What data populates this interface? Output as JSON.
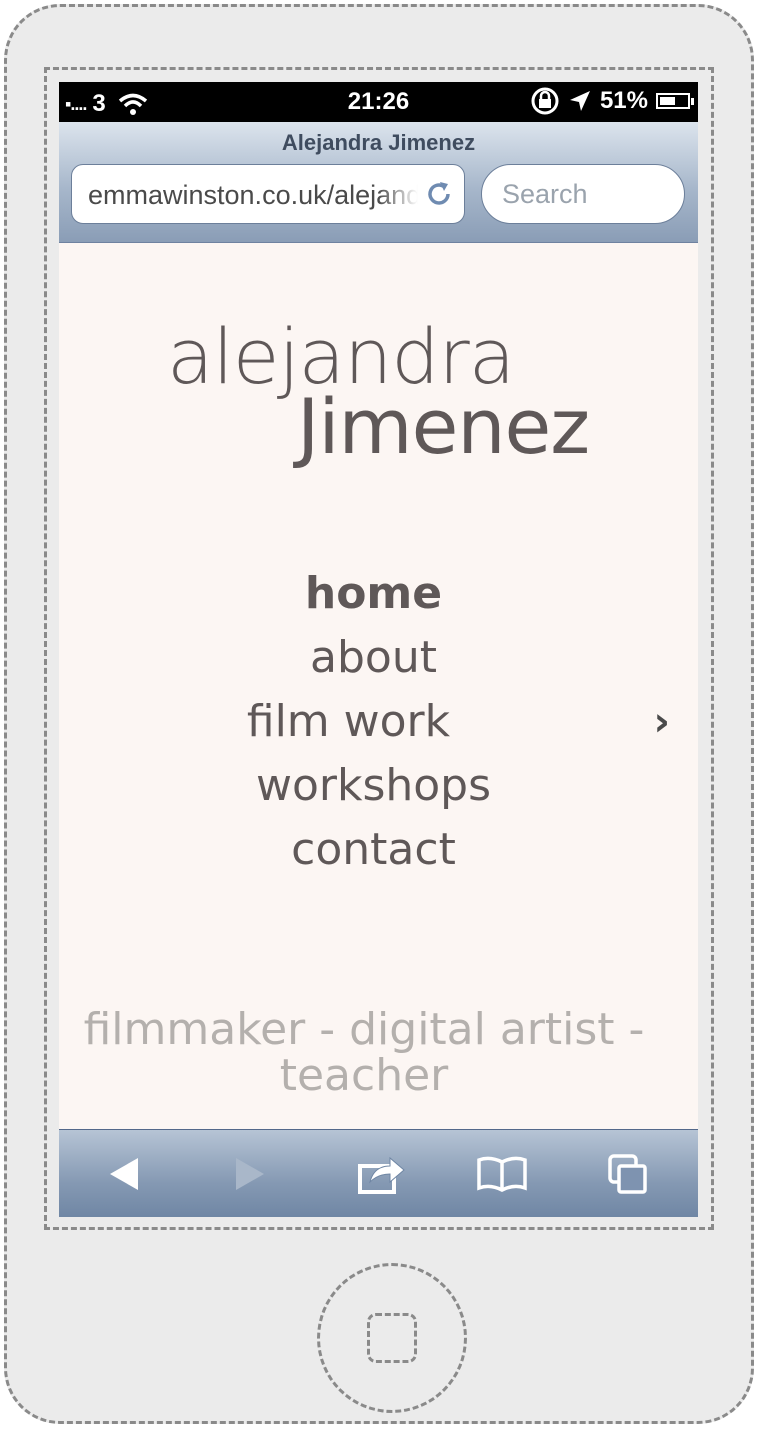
{
  "status_bar": {
    "carrier": "3",
    "time": "21:26",
    "battery": "51%",
    "battery_level": 0.51
  },
  "browser": {
    "page_title": "Alejandra Jimenez",
    "url": "emmawinston.co.uk/alejandra",
    "search_placeholder": "Search"
  },
  "logo": {
    "line1": "alejandra",
    "line2": "Jimenez"
  },
  "nav": {
    "items": [
      {
        "label": "home",
        "active": true
      },
      {
        "label": "about"
      },
      {
        "label": "film work",
        "has_submenu": true
      },
      {
        "label": "workshops"
      },
      {
        "label": "contact"
      }
    ]
  },
  "tagline": "filmmaker - digital artist - teacher",
  "toolbar": {
    "icons": [
      "back-icon",
      "forward-icon",
      "share-icon",
      "bookmarks-icon",
      "tabs-icon"
    ]
  },
  "colors": {
    "page_background": "#fcf6f3",
    "text": "#5f5858",
    "tagline": "#b4b0ad"
  }
}
